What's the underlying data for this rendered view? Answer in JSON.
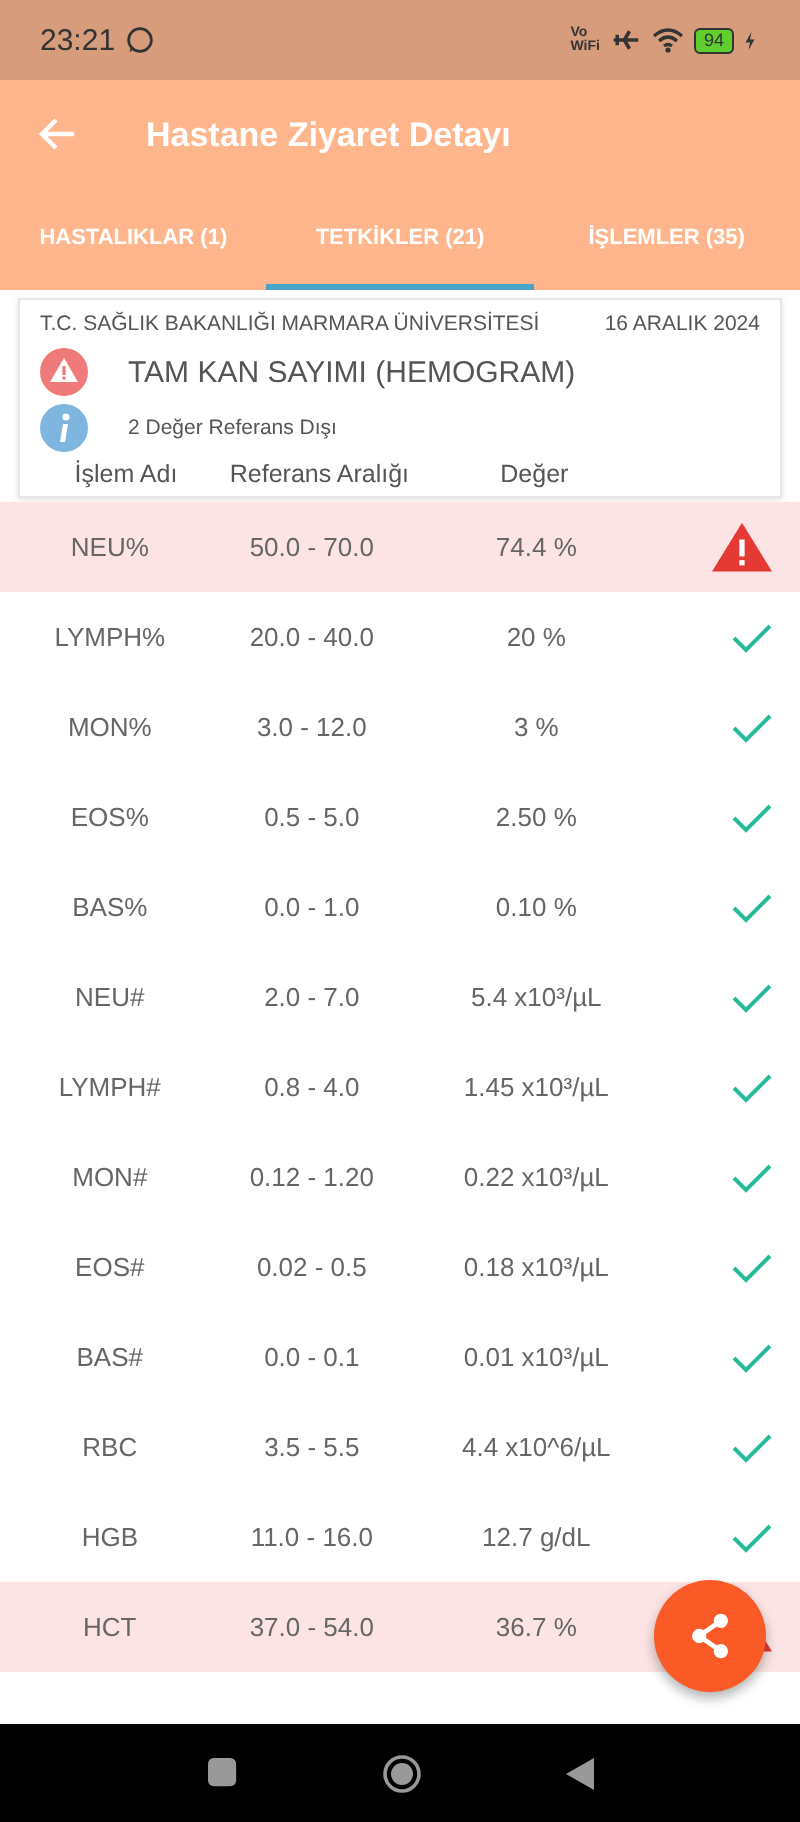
{
  "status_bar": {
    "time": "23:21",
    "vowifi": "Vo\nWiFi",
    "battery": "94"
  },
  "header": {
    "title": "Hastane Ziyaret Detayı"
  },
  "tabs": [
    {
      "label": "HASTALIKLAR (1)",
      "selected": false
    },
    {
      "label": "TETKİKLER (21)",
      "selected": true
    },
    {
      "label": "İŞLEMLER (35)",
      "selected": false
    }
  ],
  "card": {
    "institution": "T.C. SAĞLIK BAKANLIĞI MARMARA ÜNİVERSİTESİ",
    "date": "16 ARALIK 2024",
    "test_name": "TAM KAN SAYIMI (HEMOGRAM)",
    "summary": "2 Değer Referans Dışı",
    "columns": [
      "İşlem Adı",
      "Referans Aralığı",
      "Değer"
    ]
  },
  "rows": [
    {
      "name": "NEU%",
      "range": "50.0 - 70.0",
      "value": "74.4 %",
      "out_of_range": true
    },
    {
      "name": "LYMPH%",
      "range": "20.0 - 40.0",
      "value": "20 %",
      "out_of_range": false
    },
    {
      "name": "MON%",
      "range": "3.0 - 12.0",
      "value": "3 %",
      "out_of_range": false
    },
    {
      "name": "EOS%",
      "range": "0.5 - 5.0",
      "value": "2.50 %",
      "out_of_range": false
    },
    {
      "name": "BAS%",
      "range": "0.0 - 1.0",
      "value": "0.10 %",
      "out_of_range": false
    },
    {
      "name": "NEU#",
      "range": "2.0 - 7.0",
      "value": "5.4 x10³/µL",
      "out_of_range": false
    },
    {
      "name": "LYMPH#",
      "range": "0.8 - 4.0",
      "value": "1.45 x10³/µL",
      "out_of_range": false
    },
    {
      "name": "MON#",
      "range": "0.12 - 1.20",
      "value": "0.22 x10³/µL",
      "out_of_range": false
    },
    {
      "name": "EOS#",
      "range": "0.02 - 0.5",
      "value": "0.18 x10³/µL",
      "out_of_range": false
    },
    {
      "name": "BAS#",
      "range": "0.0 - 0.1",
      "value": "0.01 x10³/µL",
      "out_of_range": false
    },
    {
      "name": "RBC",
      "range": "3.5 - 5.5",
      "value": "4.4 x10^6/µL",
      "out_of_range": false
    },
    {
      "name": "HGB",
      "range": "11.0 - 16.0",
      "value": "12.7 g/dL",
      "out_of_range": false
    },
    {
      "name": "HCT",
      "range": "37.0 - 54.0",
      "value": "36.7 %",
      "out_of_range": true
    }
  ]
}
